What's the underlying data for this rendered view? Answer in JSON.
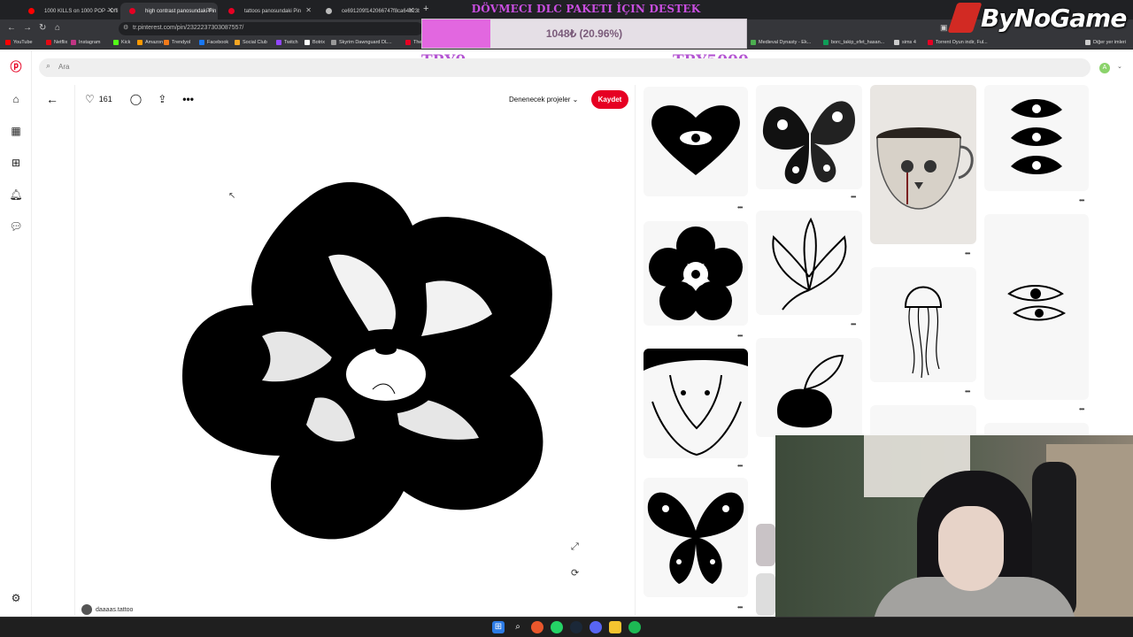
{
  "browser": {
    "tabs": [
      {
        "title": "1000 KILLS on 1000 POP - Offi",
        "active": false
      },
      {
        "title": "high contrast panosundaki Pin",
        "active": true
      },
      {
        "title": "tattoos panosundaki Pin",
        "active": false
      },
      {
        "title": "ce691209f142066747f8ca64b23ba",
        "active": false
      }
    ],
    "new_tab_label": "+",
    "url": "tr.pinterest.com/pin/2322237303087557/",
    "bookmarks": [
      {
        "label": "YouTube",
        "color": "#ff0000"
      },
      {
        "label": "Netflix",
        "color": "#e50914"
      },
      {
        "label": "Instagram",
        "color": "#c13584"
      },
      {
        "label": "Kick",
        "color": "#53fc18"
      },
      {
        "label": "Amazon",
        "color": "#ff9900"
      },
      {
        "label": "Trendyol",
        "color": "#f27a1a"
      },
      {
        "label": "Facebook",
        "color": "#1877f2"
      },
      {
        "label": "Social Club",
        "color": "#f5a623"
      },
      {
        "label": "Twitch",
        "color": "#9146ff"
      },
      {
        "label": "Botrix",
        "color": "#ffffff"
      },
      {
        "label": "Skyrim Dawnguard DL...",
        "color": "#999999"
      },
      {
        "label": "The E",
        "color": "#e60023"
      },
      {
        "label": "Medieval Dynasty - Ek...",
        "color": "#4caf50"
      },
      {
        "label": "borc_takip_efet_hasan...",
        "color": "#0f9d58"
      },
      {
        "label": "sims 4",
        "color": "#cccccc"
      },
      {
        "label": "Torrent Oyun indir, Ful...",
        "color": "#e60023"
      },
      {
        "label": "Diğer yer imleri",
        "color": "#cccccc"
      }
    ]
  },
  "overlay": {
    "dlc_title": "DÖVMECI DLC PAKETI İÇIN DESTEK",
    "progress_text": "1048₺ (20.96%)",
    "progress_fraction": 0.2096,
    "try_left": "TRY0",
    "try_right": "TRY5000",
    "brand": "ByNoGame",
    "accent_color": "#e267e0"
  },
  "pinterest": {
    "search_placeholder": "Ara",
    "avatar_letter": "A",
    "like_count": "161",
    "board_select": "Denenecek projeler",
    "save_label": "Kaydet",
    "author": "daaaas.tattoo",
    "brand_color": "#e60023",
    "sidebar_icons": [
      "pinterest-logo-icon",
      "home-icon",
      "explore-icon",
      "create-icon",
      "notifications-icon",
      "messages-icon",
      "settings-icon"
    ]
  },
  "taskbar": {
    "icons": [
      "windows-start-icon",
      "search-icon",
      "browser-icon",
      "whatsapp-icon",
      "steam-icon",
      "discord-icon",
      "file-explorer-icon",
      "spotify-icon"
    ]
  }
}
